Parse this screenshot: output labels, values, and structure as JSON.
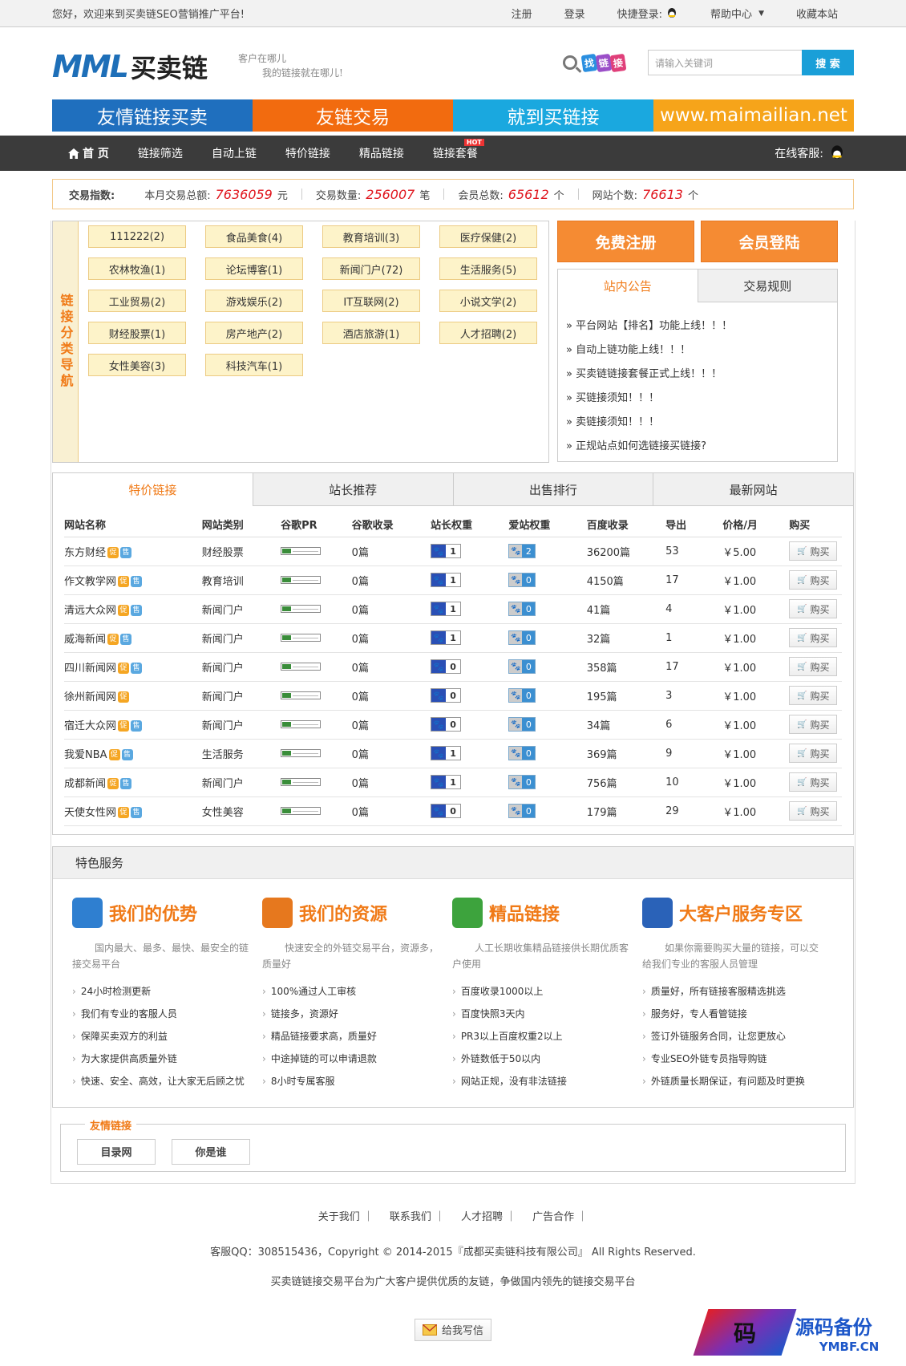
{
  "topbar": {
    "welcome": "您好，欢迎来到买卖链SEO营销推广平台!",
    "register": "注册",
    "login": "登录",
    "quick_login": "快捷登录:",
    "help": "帮助中心",
    "bookmark": "收藏本站"
  },
  "header": {
    "logo_mark": "MML",
    "logo_cn": "买卖链",
    "slogan1": "客户在哪儿",
    "slogan2": "我的链接就在哪儿!",
    "find_tag": [
      "找",
      "链",
      "接"
    ],
    "search_placeholder": "请输入关键词",
    "search_button": "搜 索"
  },
  "banner": [
    {
      "text": "友情链接买卖",
      "color": "#1f6fbe"
    },
    {
      "text": "友链交易",
      "color": "#f26b0f"
    },
    {
      "text": "就到买链接",
      "color": "#1aa8df"
    },
    {
      "text": "www.maimailian.net",
      "color": "#f6a41a"
    }
  ],
  "nav": {
    "items": [
      "首 页",
      "链接筛选",
      "自动上链",
      "特价链接",
      "精品链接",
      "链接套餐"
    ],
    "hot": "HOT",
    "service": "在线客服:"
  },
  "stats": {
    "label": "交易指数:",
    "total_label": "本月交易总额:",
    "total_value": "7636059",
    "total_unit": "元",
    "count_label": "交易数量:",
    "count_value": "256007",
    "count_unit": "笔",
    "members_label": "会员总数:",
    "members_value": "65612",
    "members_unit": "个",
    "sites_label": "网站个数:",
    "sites_value": "76613",
    "sites_unit": "个"
  },
  "categories": {
    "side_title": "链接分类导航",
    "items": [
      "111222(2)",
      "食品美食(4)",
      "教育培训(3)",
      "医疗保健(2)",
      "农林牧渔(1)",
      "论坛博客(1)",
      "新闻门户(72)",
      "生活服务(5)",
      "工业贸易(2)",
      "游戏娱乐(2)",
      "IT互联网(2)",
      "小说文学(2)",
      "财经股票(1)",
      "房产地产(2)",
      "酒店旅游(1)",
      "人才招聘(2)",
      "女性美容(3)",
      "科技汽车(1)"
    ]
  },
  "account": {
    "register": "免费注册",
    "login": "会员登陆"
  },
  "notice": {
    "tab_on": "站内公告",
    "tab_off": "交易规则",
    "items": [
      "» 平台网站【排名】功能上线！！！",
      "» 自动上链功能上线！！！",
      "» 买卖链链接套餐正式上线！！！",
      "» 买链接须知！！！",
      "» 卖链接须知！！！",
      "» 正规站点如何选链接买链接?"
    ]
  },
  "deals": {
    "tabs": [
      "特价链接",
      "站长推荐",
      "出售排行",
      "最新网站"
    ],
    "headers": [
      "网站名称",
      "网站类别",
      "谷歌PR",
      "谷歌收录",
      "站长权重",
      "爱站权重",
      "百度收录",
      "导出",
      "价格/月",
      "购买"
    ],
    "promo_badge": "促",
    "sale_badge": "售",
    "buy_label": "购买",
    "rows": [
      {
        "name": "东方财经",
        "sale": true,
        "cat": "财经股票",
        "pr": "0",
        "gidx": "0篇",
        "zz": "1",
        "az": "2",
        "bd": "36200篇",
        "out": "53",
        "price": "￥5.00"
      },
      {
        "name": "作文教学网",
        "sale": true,
        "cat": "教育培训",
        "pr": "0",
        "gidx": "0篇",
        "zz": "1",
        "az": "0",
        "bd": "4150篇",
        "out": "17",
        "price": "￥1.00"
      },
      {
        "name": "清远大众网",
        "sale": true,
        "cat": "新闻门户",
        "pr": "0",
        "gidx": "0篇",
        "zz": "1",
        "az": "0",
        "bd": "41篇",
        "out": "4",
        "price": "￥1.00"
      },
      {
        "name": "威海新闻",
        "sale": true,
        "cat": "新闻门户",
        "pr": "0",
        "gidx": "0篇",
        "zz": "1",
        "az": "0",
        "bd": "32篇",
        "out": "1",
        "price": "￥1.00"
      },
      {
        "name": "四川新闻网",
        "sale": true,
        "cat": "新闻门户",
        "pr": "0",
        "gidx": "0篇",
        "zz": "0",
        "az": "0",
        "bd": "358篇",
        "out": "17",
        "price": "￥1.00"
      },
      {
        "name": "徐州新闻网",
        "sale": false,
        "cat": "新闻门户",
        "pr": "0",
        "gidx": "0篇",
        "zz": "0",
        "az": "0",
        "bd": "195篇",
        "out": "3",
        "price": "￥1.00"
      },
      {
        "name": "宿迁大众网",
        "sale": true,
        "cat": "新闻门户",
        "pr": "0",
        "gidx": "0篇",
        "zz": "0",
        "az": "0",
        "bd": "34篇",
        "out": "6",
        "price": "￥1.00"
      },
      {
        "name": "我爱NBA",
        "sale": true,
        "cat": "生活服务",
        "pr": "0",
        "gidx": "0篇",
        "zz": "1",
        "az": "0",
        "bd": "369篇",
        "out": "9",
        "price": "￥1.00"
      },
      {
        "name": "成都新闻",
        "sale": true,
        "cat": "新闻门户",
        "pr": "0",
        "gidx": "0篇",
        "zz": "1",
        "az": "0",
        "bd": "756篇",
        "out": "10",
        "price": "￥1.00"
      },
      {
        "name": "天使女性网",
        "sale": true,
        "cat": "女性美容",
        "pr": "0",
        "gidx": "0篇",
        "zz": "0",
        "az": "0",
        "bd": "179篇",
        "out": "29",
        "price": "￥1.00"
      }
    ]
  },
  "services": {
    "title": "特色服务",
    "cols": [
      {
        "title": "我们的优势",
        "icon": "user-check-icon",
        "desc": "国内最大、最多、最快、最安全的链接交易平台",
        "items": [
          "24小时检测更新",
          "我们有专业的客服人员",
          "保障买卖双方的利益",
          "为大家提供高质量外链",
          "快速、安全、高效，让大家无后顾之忧"
        ]
      },
      {
        "title": "我们的资源",
        "icon": "bar-chart-icon",
        "desc": "快速安全的外链交易平台，资源多，质量好",
        "items": [
          "100%通过人工审核",
          "链接多，资源好",
          "精品链接要求高，质量好",
          "中途掉链的可以申请退款",
          "8小时专属客服"
        ]
      },
      {
        "title": "精品链接",
        "icon": "check-badge-icon",
        "desc": "人工长期收集精品链接供长期优质客户使用",
        "items": [
          "百度收录1000以上",
          "百度快照3天内",
          "PR3以上百度权重2以上",
          "外链数低于50以内",
          "网站正规，没有非法链接"
        ]
      },
      {
        "title": "大客户服务专区",
        "icon": "globe-icon",
        "desc": "如果你需要购买大量的链接，可以交给我们专业的客服人员管理",
        "items": [
          "质量好，所有链接客服精选挑选",
          "服务好，专人看管链接",
          "签订外链服务合同，让您更放心",
          "专业SEO外链专员指导购链",
          "外链质量长期保证，有问题及时更换"
        ]
      }
    ]
  },
  "friend": {
    "legend": "友情链接",
    "links": [
      "目录网",
      "你是谁"
    ]
  },
  "footer": {
    "links": [
      "关于我们",
      "联系我们",
      "人才招聘",
      "广告合作"
    ],
    "copyright": "客服QQ：308515436，Copyright © 2014-2015『成都买卖链科技有限公司』 All Rights Reserved.",
    "desc": "买卖链链接交易平台为广大客户提供优质的友链，争做国内领先的链接交易平台",
    "mail": "给我写信"
  },
  "watermark": {
    "glyph": "码",
    "name": "源码备份",
    "domain": "YMBF.CN"
  }
}
